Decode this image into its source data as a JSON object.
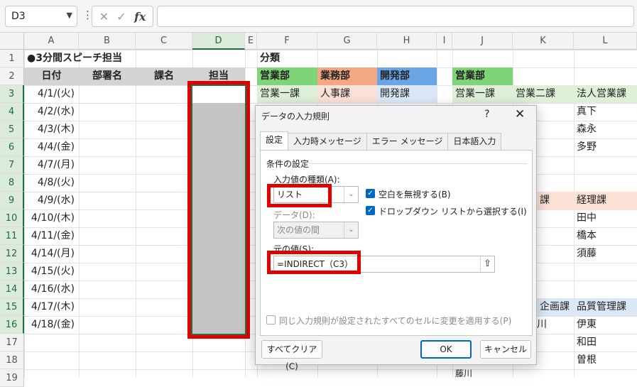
{
  "formula_bar": {
    "name_box": "D3",
    "cancel_icon": "✕",
    "enter_icon": "✓",
    "fx_label": "fx"
  },
  "columns": [
    "A",
    "B",
    "C",
    "D",
    "E",
    "F",
    "G",
    "H",
    "I",
    "J",
    "K",
    "L"
  ],
  "rows": [
    "1",
    "2",
    "3",
    "4",
    "5",
    "6",
    "7",
    "8",
    "9",
    "10",
    "11",
    "12",
    "13",
    "14",
    "15",
    "16",
    "17",
    "18",
    "19"
  ],
  "sheet": {
    "title": "●3分間スピーチ担当",
    "headers": [
      "日付",
      "部署名",
      "課名",
      "担当"
    ],
    "dates": [
      "4/1/(火)",
      "4/2/(水)",
      "4/3/(木)",
      "4/4/(金)",
      "4/7/(月)",
      "4/8/(火)",
      "4/9/(水)",
      "4/10/(木)",
      "4/11/(金)",
      "4/14/(月)",
      "4/15/(火)",
      "4/16/(水)",
      "4/17/(木)",
      "4/18/(金)"
    ],
    "category_title": "分類",
    "dept_headers": [
      "営業部",
      "業務部",
      "開発部"
    ],
    "dept_sections": [
      "営業一課",
      "人事課",
      "開発課"
    ],
    "right_header": "営業部",
    "right_row3": [
      "営業一課",
      "営業二課",
      "法人営業課"
    ],
    "col_l_names_a": [
      "真下",
      "森永",
      "多野"
    ],
    "row9_k": "課",
    "row9_l": "経理課",
    "col_l_names_b": [
      "田中",
      "橋本",
      "須藤"
    ],
    "row15_k": "企画課",
    "row15_l": "品質管理課",
    "row16_k": "川",
    "col_l_names_c": [
      "伊東",
      "和田",
      "曽根"
    ],
    "row19_j": "藤川"
  },
  "dialog": {
    "title": "データの入力規則",
    "help": "?",
    "close": "✕",
    "tabs": [
      "設定",
      "入力時メッセージ",
      "エラー メッセージ",
      "日本語入力"
    ],
    "section_label": "条件の設定",
    "allow_label": "入力値の種類(A):",
    "allow_value": "リスト",
    "ignore_blank": "空白を無視する(B)",
    "dropdown": "ドロップダウン リストから選択する(I)",
    "data_label": "データ(D):",
    "data_value": "次の値の間",
    "source_label": "元の値(S):",
    "source_value": "=INDIRECT（C3）",
    "apply_all": "同じ入力規則が設定されたすべてのセルに変更を適用する(P)",
    "clear_all": "すべてクリア(C)",
    "ok": "OK",
    "cancel": "キャンセル"
  }
}
